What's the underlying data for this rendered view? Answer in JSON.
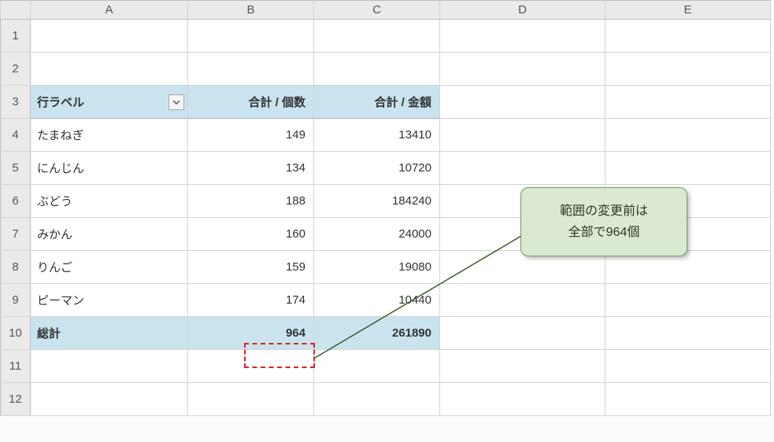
{
  "columns": [
    "A",
    "B",
    "C",
    "D",
    "E"
  ],
  "rows": [
    "1",
    "2",
    "3",
    "4",
    "5",
    "6",
    "7",
    "8",
    "9",
    "10",
    "11",
    "12"
  ],
  "pivot": {
    "header": {
      "row_label": "行ラベル",
      "sum_qty": "合計 / 個数",
      "sum_amt": "合計 / 金額"
    },
    "items": [
      {
        "name": "たまねぎ",
        "qty": "149",
        "amt": "13410"
      },
      {
        "name": "にんじん",
        "qty": "134",
        "amt": "10720"
      },
      {
        "name": "ぶどう",
        "qty": "188",
        "amt": "184240"
      },
      {
        "name": "みかん",
        "qty": "160",
        "amt": "24000"
      },
      {
        "name": "りんご",
        "qty": "159",
        "amt": "19080"
      },
      {
        "name": "ピーマン",
        "qty": "174",
        "amt": "10440"
      }
    ],
    "total": {
      "label": "総計",
      "qty": "964",
      "amt": "261890"
    }
  },
  "callout": {
    "line1": "範囲の変更前は",
    "line2": "全部で964個"
  }
}
